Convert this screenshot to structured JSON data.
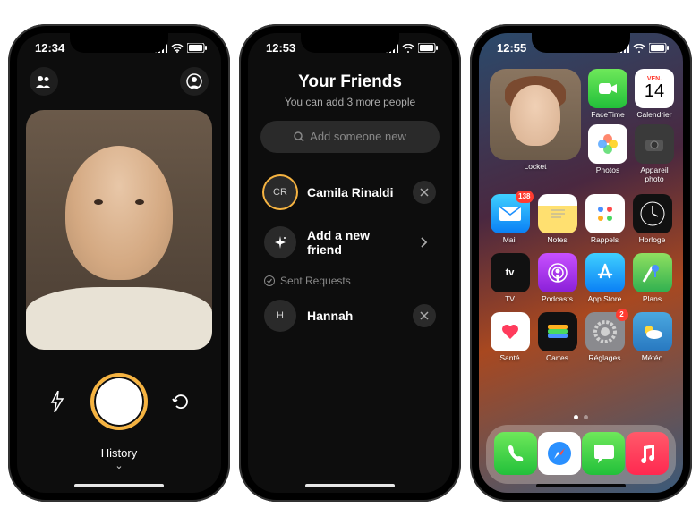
{
  "phone1": {
    "time": "12:34",
    "history_label": "History"
  },
  "phone2": {
    "time": "12:53",
    "title": "Your Friends",
    "subtitle": "You can add 3 more people",
    "search_placeholder": "Add someone new",
    "friends": [
      {
        "initials": "CR",
        "name": "Camila Rinaldi"
      }
    ],
    "add_friend_label": "Add a new friend",
    "sent_requests_label": "Sent Requests",
    "requests": [
      {
        "initials": "H",
        "name": "Hannah"
      }
    ]
  },
  "phone3": {
    "time": "12:55",
    "locket_label": "Locket",
    "calendar": {
      "day": "VEN.",
      "date": "14"
    },
    "apps_top": [
      {
        "label": "FaceTime",
        "color": "linear-gradient(#6ee85a,#22c03a)",
        "glyph": "video"
      },
      {
        "label": "Calendrier",
        "color": "#fff",
        "glyph": "calendar"
      },
      {
        "label": "Photos",
        "color": "#fff",
        "glyph": "photos"
      },
      {
        "label": "Appareil photo",
        "color": "#3a3a3a",
        "glyph": "camera"
      }
    ],
    "apps_grid": [
      {
        "label": "Mail",
        "color": "linear-gradient(#3fd0ff,#0a7ff5)",
        "glyph": "mail",
        "badge": "138"
      },
      {
        "label": "Notes",
        "color": "linear-gradient(#fff 30%,#ffe070 30%)",
        "glyph": "notes"
      },
      {
        "label": "Rappels",
        "color": "#fff",
        "glyph": "reminders"
      },
      {
        "label": "Horloge",
        "color": "#111",
        "glyph": "clock"
      },
      {
        "label": "TV",
        "color": "#111",
        "glyph": "tv"
      },
      {
        "label": "Podcasts",
        "color": "linear-gradient(#c850ff,#8a20d8)",
        "glyph": "podcast"
      },
      {
        "label": "App Store",
        "color": "linear-gradient(#3fd0ff,#0a7ff5)",
        "glyph": "appstore"
      },
      {
        "label": "Plans",
        "color": "linear-gradient(#8fe060,#30b050)",
        "glyph": "maps"
      },
      {
        "label": "Santé",
        "color": "#fff",
        "glyph": "health"
      },
      {
        "label": "Cartes",
        "color": "#111",
        "glyph": "wallet"
      },
      {
        "label": "Réglages",
        "color": "#8a8a8e",
        "glyph": "settings",
        "badge": "2"
      },
      {
        "label": "Météo",
        "color": "linear-gradient(#4aa8e0,#2878c0)",
        "glyph": "weather"
      }
    ],
    "dock": [
      {
        "name": "phone",
        "color": "linear-gradient(#6ee85a,#22c03a)",
        "glyph": "phone"
      },
      {
        "name": "safari",
        "color": "#fff",
        "glyph": "safari"
      },
      {
        "name": "messages",
        "color": "linear-gradient(#6ee85a,#22c03a)",
        "glyph": "messages"
      },
      {
        "name": "music",
        "color": "linear-gradient(#ff5a6a,#ff2850)",
        "glyph": "music"
      }
    ]
  }
}
